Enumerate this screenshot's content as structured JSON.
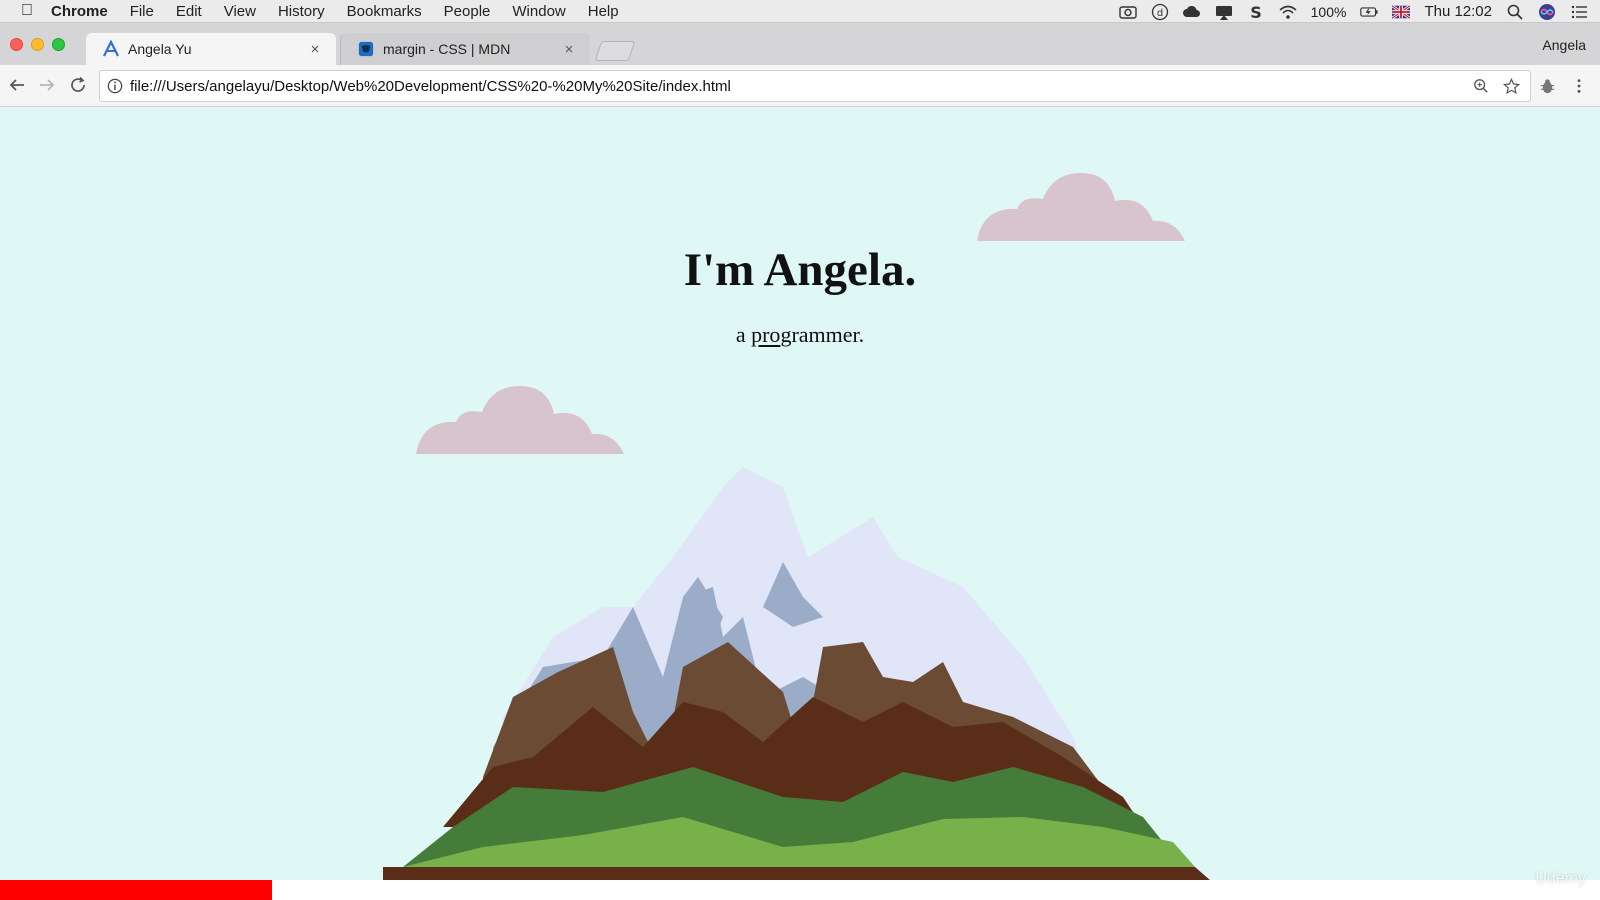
{
  "menubar": {
    "app": "Chrome",
    "items": [
      "File",
      "Edit",
      "View",
      "History",
      "Bookmarks",
      "People",
      "Window",
      "Help"
    ],
    "battery": "100%",
    "clock": "Thu 12:02",
    "tray_icons": [
      "video-icon",
      "d-icon",
      "cloud-icon",
      "airplay-icon",
      "s-icon",
      "wifi-icon",
      "battery-icon",
      "uk-flag-icon",
      "spotlight-icon",
      "siri-icon",
      "list-icon"
    ]
  },
  "tabs": [
    {
      "title": "Angela Yu",
      "icon": "angela-favicon",
      "active": true
    },
    {
      "title": "margin - CSS | MDN",
      "icon": "mdn-favicon",
      "active": false
    }
  ],
  "profile_name": "Angela",
  "toolbar": {
    "url": "file:///Users/angelayu/Desktop/Web%20Development/CSS%20-%20My%20Site/index.html"
  },
  "page": {
    "title": "I'm Angela.",
    "subtitle_prefix": "a ",
    "subtitle_underlined": "pro",
    "subtitle_suffix": "grammer."
  },
  "colors": {
    "page_bg": "#e0f8f5",
    "cloud": "#d8c4cc",
    "snow": "#e0e6f8",
    "rock_light": "#9aacc8",
    "brown": "#6c4b34",
    "dark_brown": "#5a2d18",
    "green_dark": "#457c3a",
    "green_light": "#78b04a",
    "progress": "#ff0000"
  },
  "progress": {
    "value": 0.17
  },
  "watermark": "Udemy"
}
